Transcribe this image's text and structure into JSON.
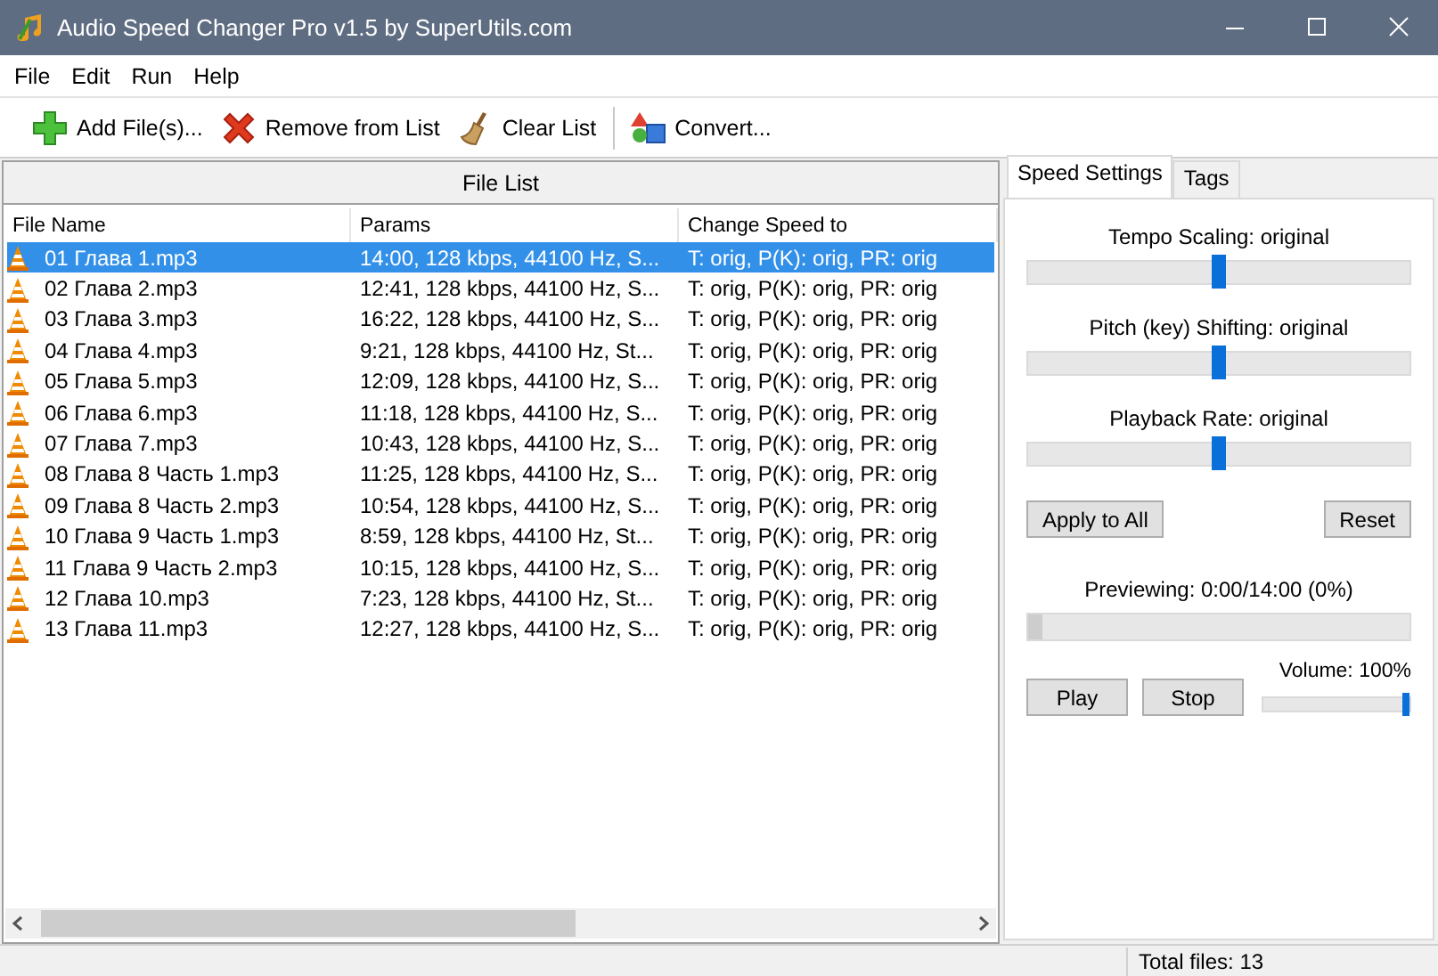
{
  "window": {
    "title": "Audio Speed Changer Pro v1.5 by SuperUtils.com"
  },
  "menu": [
    "File",
    "Edit",
    "Run",
    "Help"
  ],
  "toolbar": [
    {
      "kind": "add",
      "label": "Add File(s)..."
    },
    {
      "kind": "remove",
      "label": "Remove from List"
    },
    {
      "kind": "clear",
      "label": "Clear List"
    },
    {
      "kind": "convert",
      "label": "Convert..."
    }
  ],
  "file_list": {
    "title": "File List",
    "columns": [
      "File Name",
      "Params",
      "Change Speed to"
    ],
    "rows": [
      {
        "name": "01 Глава 1.mp3",
        "params": "14:00, 128 kbps, 44100 Hz, S...",
        "speed": "T: orig, P(K): orig, PR: orig",
        "selected": true
      },
      {
        "name": "02 Глава 2.mp3",
        "params": "12:41, 128 kbps, 44100 Hz, S...",
        "speed": "T: orig, P(K): orig, PR: orig",
        "selected": false
      },
      {
        "name": "03 Глава 3.mp3",
        "params": "16:22, 128 kbps, 44100 Hz, S...",
        "speed": "T: orig, P(K): orig, PR: orig",
        "selected": false
      },
      {
        "name": "04 Глава 4.mp3",
        "params": "9:21, 128 kbps, 44100 Hz, St...",
        "speed": "T: orig, P(K): orig, PR: orig",
        "selected": false
      },
      {
        "name": "05 Глава 5.mp3",
        "params": "12:09, 128 kbps, 44100 Hz, S...",
        "speed": "T: orig, P(K): orig, PR: orig",
        "selected": false
      },
      {
        "name": "06 Глава 6.mp3",
        "params": "11:18, 128 kbps, 44100 Hz, S...",
        "speed": "T: orig, P(K): orig, PR: orig",
        "selected": false
      },
      {
        "name": "07 Глава 7.mp3",
        "params": "10:43, 128 kbps, 44100 Hz, S...",
        "speed": "T: orig, P(K): orig, PR: orig",
        "selected": false
      },
      {
        "name": "08 Глава 8 Часть 1.mp3",
        "params": "11:25, 128 kbps, 44100 Hz, S...",
        "speed": "T: orig, P(K): orig, PR: orig",
        "selected": false
      },
      {
        "name": "09 Глава 8 Часть 2.mp3",
        "params": "10:54, 128 kbps, 44100 Hz, S...",
        "speed": "T: orig, P(K): orig, PR: orig",
        "selected": false
      },
      {
        "name": "10 Глава 9 Часть 1.mp3",
        "params": "8:59, 128 kbps, 44100 Hz, St...",
        "speed": "T: orig, P(K): orig, PR: orig",
        "selected": false
      },
      {
        "name": "11 Глава 9 Часть 2.mp3",
        "params": "10:15, 128 kbps, 44100 Hz, S...",
        "speed": "T: orig, P(K): orig, PR: orig",
        "selected": false
      },
      {
        "name": "12 Глава 10.mp3",
        "params": "7:23, 128 kbps, 44100 Hz, St...",
        "speed": "T: orig, P(K): orig, PR: orig",
        "selected": false
      },
      {
        "name": "13 Глава 11.mp3",
        "params": "12:27, 128 kbps, 44100 Hz, S...",
        "speed": "T: orig, P(K): orig, PR: orig",
        "selected": false
      }
    ]
  },
  "tabs": [
    {
      "label": "Speed Settings",
      "selected": true
    },
    {
      "label": "Tags",
      "selected": false
    }
  ],
  "sliders": [
    {
      "label": "Tempo Scaling: original",
      "level": 0.5
    },
    {
      "label": "Pitch (key) Shifting: original",
      "level": 0.5
    },
    {
      "label": "Playback Rate: original",
      "level": 0.5
    }
  ],
  "settings_buttons": [
    "Apply to All",
    "Reset"
  ],
  "preview": {
    "label": "Previewing: 0:00/14:00 (0%)",
    "level": 0
  },
  "playback_buttons": [
    "Play",
    "Stop"
  ],
  "volume": {
    "label": "Volume: 100%",
    "level": 1
  },
  "status_bar": {
    "total": "Total files: 13"
  }
}
